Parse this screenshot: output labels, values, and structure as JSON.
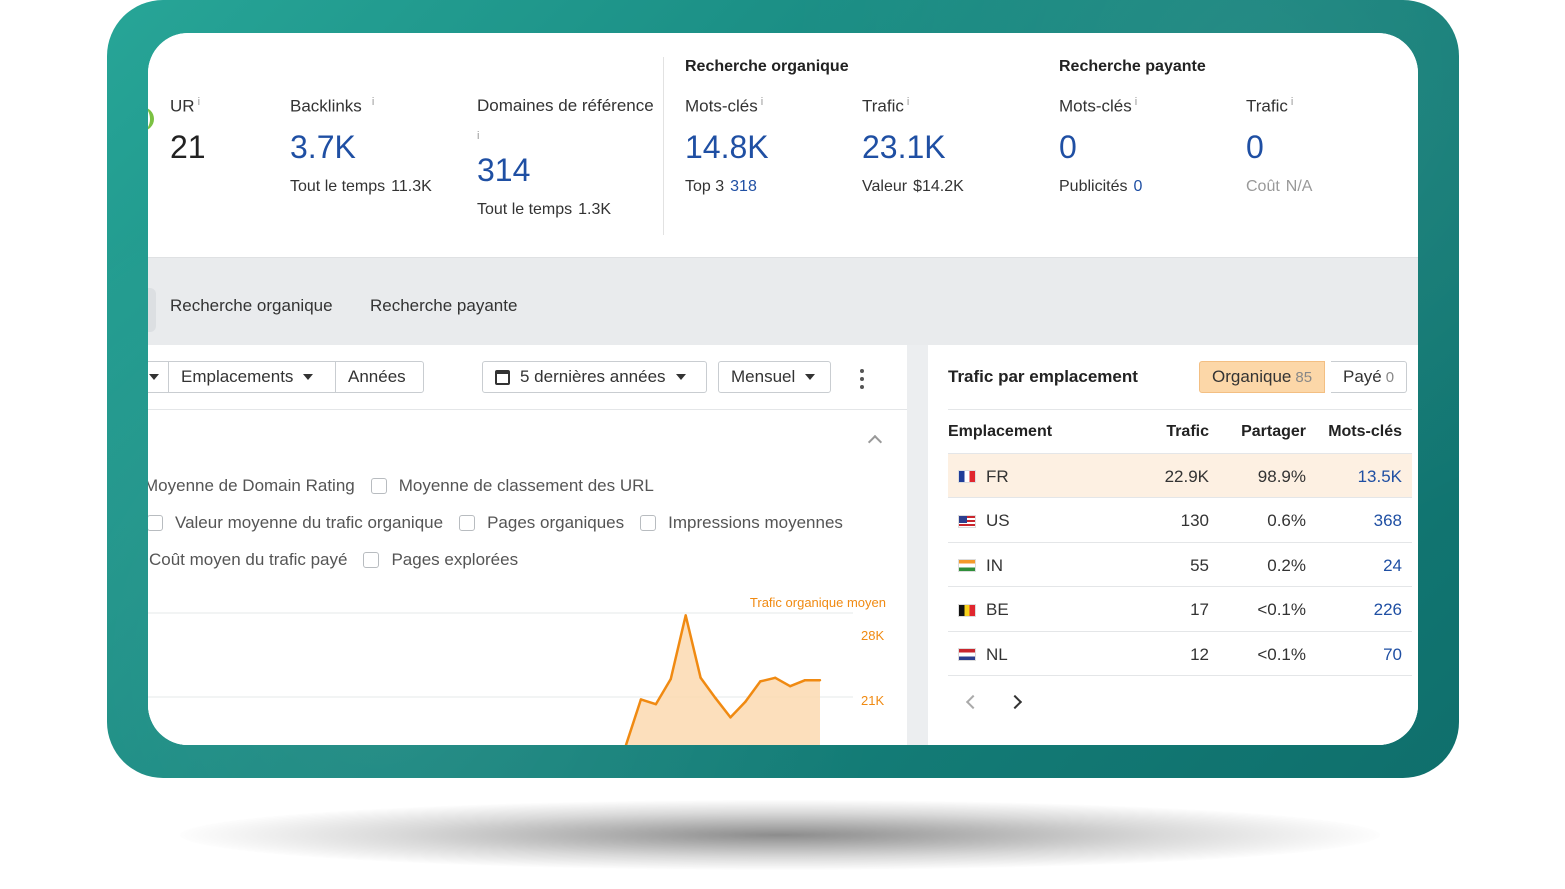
{
  "metrics": {
    "ur": {
      "label": "UR",
      "value": "21"
    },
    "backlinks": {
      "label": "Backlinks",
      "value": "3.7K",
      "sub_label": "Tout le temps",
      "sub_value": "11.3K"
    },
    "ref_domains": {
      "label": "Domaines de référence",
      "value": "314",
      "sub_label": "Tout le temps",
      "sub_value": "1.3K"
    },
    "info_glyph": "i",
    "organic": {
      "title": "Recherche organique",
      "keywords": {
        "label": "Mots-clés",
        "value": "14.8K",
        "sub_label": "Top 3",
        "sub_value": "318"
      },
      "traffic": {
        "label": "Trafic",
        "value": "23.1K",
        "sub_label": "Valeur",
        "sub_value": "$14.2K"
      }
    },
    "paid": {
      "title": "Recherche payante",
      "keywords": {
        "label": "Mots-clés",
        "value": "0",
        "sub_label": "Publicités",
        "sub_value": "0"
      },
      "traffic": {
        "label": "Trafic",
        "value": "0",
        "sub_label": "Coût",
        "sub_value": "N/A"
      }
    }
  },
  "tabs": [
    "Recherche organique",
    "Recherche payante"
  ],
  "toolbar": {
    "locations": "Emplacements",
    "years": "Années",
    "period": "5 dernières années",
    "interval": "Mensuel"
  },
  "checkboxes": {
    "row1": [
      "Moyenne de Domain Rating",
      "Moyenne de classement des URL"
    ],
    "row2": [
      "Valeur moyenne du trafic organique",
      "Pages organiques",
      "Impressions moyennes"
    ],
    "row3": [
      "Coût moyen du trafic payé",
      "Pages explorées"
    ]
  },
  "chart_data": {
    "type": "area",
    "series": [
      {
        "name": "Trafic organique moyen",
        "color": "#f08a12",
        "values": [
          17000,
          20800,
          20400,
          22500,
          27800,
          22600,
          20900,
          19300,
          20600,
          22300,
          22600,
          21900,
          22400,
          22400
        ]
      }
    ],
    "y_ticks": [
      "28K",
      "21K"
    ],
    "y_tick_values": [
      28000,
      21000
    ],
    "ylim": [
      17000,
      28000
    ]
  },
  "traffic_by_location": {
    "title": "Trafic par emplacement",
    "toggle": {
      "organic_label": "Organique",
      "organic_count": "85",
      "paid_label": "Payé",
      "paid_count": "0"
    },
    "columns": [
      "Emplacement",
      "Trafic",
      "Partager",
      "Mots-clés"
    ],
    "rows": [
      {
        "code": "FR",
        "traffic": "22.9K",
        "share": "98.9%",
        "keywords": "13.5K"
      },
      {
        "code": "US",
        "traffic": "130",
        "share": "0.6%",
        "keywords": "368"
      },
      {
        "code": "IN",
        "traffic": "55",
        "share": "0.2%",
        "keywords": "24"
      },
      {
        "code": "BE",
        "traffic": "17",
        "share": "<0.1%",
        "keywords": "226"
      },
      {
        "code": "NL",
        "traffic": "12",
        "share": "<0.1%",
        "keywords": "70"
      }
    ]
  },
  "colors": {
    "accent_blue": "#1f4fa3",
    "chart_orange": "#f08a12",
    "highlight_row": "#fdf0e2",
    "frame_teal": "#17877f"
  }
}
